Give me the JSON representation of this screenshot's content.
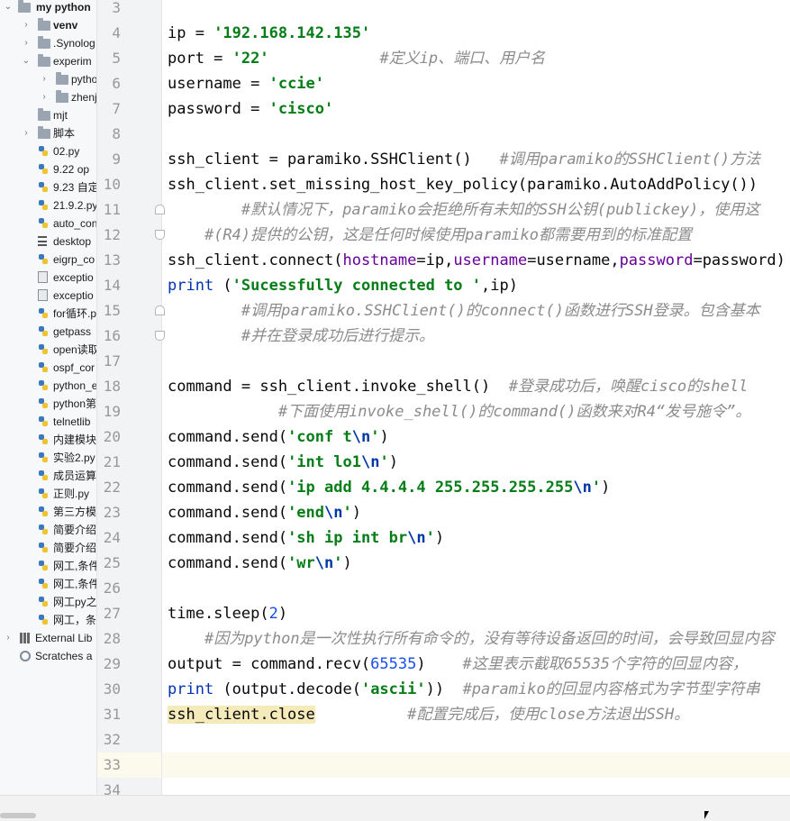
{
  "project": {
    "root": "my python",
    "items": [
      {
        "label": "venv",
        "kind": "folder",
        "level": 1,
        "arrow": "right",
        "bold": true
      },
      {
        "label": ".Synolog",
        "kind": "folder",
        "level": 1,
        "arrow": "right"
      },
      {
        "label": "experim",
        "kind": "folder",
        "level": 1,
        "arrow": "down"
      },
      {
        "label": "pytho",
        "kind": "folder",
        "level": 2,
        "arrow": "right"
      },
      {
        "label": "zhenj",
        "kind": "folder",
        "level": 2,
        "arrow": "right"
      },
      {
        "label": "mjt",
        "kind": "folder",
        "level": 1,
        "arrow": ""
      },
      {
        "label": "脚本",
        "kind": "folder",
        "level": 1,
        "arrow": "right"
      },
      {
        "label": "02.py",
        "kind": "py",
        "level": 1
      },
      {
        "label": "9.22  op",
        "kind": "py",
        "level": 1
      },
      {
        "label": "9.23 自定",
        "kind": "py",
        "level": 1
      },
      {
        "label": "21.9.2.py",
        "kind": "py",
        "level": 1
      },
      {
        "label": "auto_con",
        "kind": "py",
        "level": 1
      },
      {
        "label": "desktop",
        "kind": "txt",
        "level": 1
      },
      {
        "label": "eigrp_co",
        "kind": "py",
        "level": 1
      },
      {
        "label": "exceptio",
        "kind": "file",
        "level": 1
      },
      {
        "label": "exceptio",
        "kind": "file",
        "level": 1
      },
      {
        "label": "for循环.p",
        "kind": "py",
        "level": 1
      },
      {
        "label": "getpass",
        "kind": "py",
        "level": 1
      },
      {
        "label": "open读取",
        "kind": "py",
        "level": 1
      },
      {
        "label": "ospf_cor",
        "kind": "py",
        "level": 1
      },
      {
        "label": "python_e",
        "kind": "py",
        "level": 1
      },
      {
        "label": "python第",
        "kind": "py",
        "level": 1
      },
      {
        "label": "telnetlib",
        "kind": "py",
        "level": 1
      },
      {
        "label": "内建模块",
        "kind": "py",
        "level": 1
      },
      {
        "label": "实验2.py",
        "kind": "py",
        "level": 1
      },
      {
        "label": "成员运算",
        "kind": "py",
        "level": 1
      },
      {
        "label": "正则.py",
        "kind": "py",
        "level": 1
      },
      {
        "label": "第三方模",
        "kind": "py",
        "level": 1
      },
      {
        "label": "简要介绍",
        "kind": "py",
        "level": 1
      },
      {
        "label": "简要介绍",
        "kind": "py",
        "level": 1
      },
      {
        "label": "网工,条件",
        "kind": "py",
        "level": 1
      },
      {
        "label": "网工,条件",
        "kind": "py",
        "level": 1
      },
      {
        "label": "网工py之",
        "kind": "py",
        "level": 1
      },
      {
        "label": "网工，条",
        "kind": "py",
        "level": 1
      },
      {
        "label": "External Lib",
        "kind": "lib",
        "level": 0,
        "arrow": "right"
      },
      {
        "label": "Scratches a",
        "kind": "scratch",
        "level": 0,
        "arrow": ""
      }
    ]
  },
  "editor": {
    "current_line": 33,
    "lines": [
      {
        "n": "3",
        "segs": []
      },
      {
        "n": "4",
        "segs": [
          [
            "",
            "ip = "
          ],
          [
            "s",
            "'192.168.142.135'"
          ]
        ]
      },
      {
        "n": "5",
        "segs": [
          [
            "",
            "port = "
          ],
          [
            "s",
            "'22'"
          ],
          [
            "",
            "            "
          ],
          [
            "cm",
            "#定义ip、端口、用户名"
          ]
        ]
      },
      {
        "n": "6",
        "segs": [
          [
            "",
            "username = "
          ],
          [
            "s",
            "'ccie'"
          ]
        ]
      },
      {
        "n": "7",
        "segs": [
          [
            "",
            "password = "
          ],
          [
            "s",
            "'cisco'"
          ]
        ]
      },
      {
        "n": "8",
        "segs": []
      },
      {
        "n": "9",
        "segs": [
          [
            "",
            "ssh_client = paramiko.SSHClient()   "
          ],
          [
            "cm",
            "#调用paramiko的SSHClient()方法"
          ]
        ]
      },
      {
        "n": "10",
        "segs": [
          [
            "",
            "ssh_client.set_missing_host_key_policy(paramiko.AutoAddPolicy())"
          ]
        ]
      },
      {
        "n": "11",
        "segs": [
          [
            "",
            "        "
          ],
          [
            "cm",
            "#默认情况下，paramiko会拒绝所有未知的SSH公钥(publickey)，使用这"
          ]
        ]
      },
      {
        "n": "12",
        "segs": [
          [
            "",
            "    "
          ],
          [
            "cm",
            "#(R4)提供的公钥，这是任何时候使用paramiko都需要用到的标准配置"
          ]
        ]
      },
      {
        "n": "13",
        "segs": [
          [
            "",
            "ssh_client.connect("
          ],
          [
            "pm",
            "hostname"
          ],
          [
            "",
            "=ip,"
          ],
          [
            "pm",
            "username"
          ],
          [
            "",
            "=username,"
          ],
          [
            "pm",
            "password"
          ],
          [
            "",
            "=password)"
          ]
        ]
      },
      {
        "n": "14",
        "segs": [
          [
            "kw",
            "print"
          ],
          [
            "",
            " ("
          ],
          [
            "s",
            "'Sucessfully connected to '"
          ],
          [
            "",
            ",ip)"
          ]
        ]
      },
      {
        "n": "15",
        "segs": [
          [
            "",
            "        "
          ],
          [
            "cm",
            "#调用paramiko.SSHClient()的connect()函数进行SSH登录。包含基本"
          ]
        ]
      },
      {
        "n": "16",
        "segs": [
          [
            "",
            "        "
          ],
          [
            "cm",
            "#并在登录成功后进行提示。"
          ]
        ]
      },
      {
        "n": "17",
        "segs": []
      },
      {
        "n": "18",
        "segs": [
          [
            "",
            "command = ssh_client.invoke_shell()  "
          ],
          [
            "cm",
            "#登录成功后，唤醒cisco的shell"
          ]
        ]
      },
      {
        "n": "19",
        "segs": [
          [
            "",
            "            "
          ],
          [
            "cm",
            "#下面使用invoke_shell()的command()函数来对R4“发号施令”。"
          ]
        ]
      },
      {
        "n": "20",
        "segs": [
          [
            "",
            "command.send("
          ],
          [
            "s",
            "'conf t"
          ],
          [
            "esc",
            "\\n"
          ],
          [
            "s",
            "'"
          ],
          [
            "",
            ")"
          ]
        ]
      },
      {
        "n": "21",
        "segs": [
          [
            "",
            "command.send("
          ],
          [
            "s",
            "'int lo1"
          ],
          [
            "esc",
            "\\n"
          ],
          [
            "s",
            "'"
          ],
          [
            "",
            ")"
          ]
        ]
      },
      {
        "n": "22",
        "segs": [
          [
            "",
            "command.send("
          ],
          [
            "s",
            "'ip add 4.4.4.4 255.255.255.255"
          ],
          [
            "esc",
            "\\n"
          ],
          [
            "s",
            "'"
          ],
          [
            "",
            ")"
          ]
        ]
      },
      {
        "n": "23",
        "segs": [
          [
            "",
            "command.send("
          ],
          [
            "s",
            "'end"
          ],
          [
            "esc",
            "\\n"
          ],
          [
            "s",
            "'"
          ],
          [
            "",
            ")"
          ]
        ]
      },
      {
        "n": "24",
        "segs": [
          [
            "",
            "command.send("
          ],
          [
            "s",
            "'sh ip int br"
          ],
          [
            "esc",
            "\\n"
          ],
          [
            "s",
            "'"
          ],
          [
            "",
            ")"
          ]
        ]
      },
      {
        "n": "25",
        "segs": [
          [
            "",
            "command.send("
          ],
          [
            "s",
            "'wr"
          ],
          [
            "esc",
            "\\n"
          ],
          [
            "s",
            "'"
          ],
          [
            "",
            ")"
          ]
        ]
      },
      {
        "n": "26",
        "segs": []
      },
      {
        "n": "27",
        "segs": [
          [
            "",
            "time.sleep("
          ],
          [
            "nm",
            "2"
          ],
          [
            "",
            ")"
          ]
        ]
      },
      {
        "n": "28",
        "segs": [
          [
            "",
            "    "
          ],
          [
            "cm",
            "#因为python是一次性执行所有命令的，没有等待设备返回的时间，会导致回显内容"
          ]
        ]
      },
      {
        "n": "29",
        "segs": [
          [
            "",
            "output = command.recv("
          ],
          [
            "nm",
            "65535"
          ],
          [
            "",
            ")    "
          ],
          [
            "cm",
            "#这里表示截取65535个字符的回显内容，"
          ]
        ]
      },
      {
        "n": "30",
        "segs": [
          [
            "kw",
            "print"
          ],
          [
            "",
            " (output.decode("
          ],
          [
            "s",
            "'ascii'"
          ],
          [
            "",
            "))  "
          ],
          [
            "cm",
            "#paramiko的回显内容格式为字节型字符串"
          ]
        ]
      },
      {
        "n": "31",
        "segs": [
          [
            "hl",
            "ssh_client.close"
          ],
          [
            "",
            "          "
          ],
          [
            "cm",
            "#配置完成后，使用close方法退出SSH。"
          ]
        ]
      },
      {
        "n": "32",
        "segs": []
      },
      {
        "n": "33",
        "segs": []
      },
      {
        "n": "34",
        "segs": []
      }
    ],
    "folds": [
      {
        "line": "11",
        "dir": "dn"
      },
      {
        "line": "12",
        "dir": "up"
      },
      {
        "line": "15",
        "dir": "dn"
      },
      {
        "line": "16",
        "dir": "up"
      }
    ]
  }
}
